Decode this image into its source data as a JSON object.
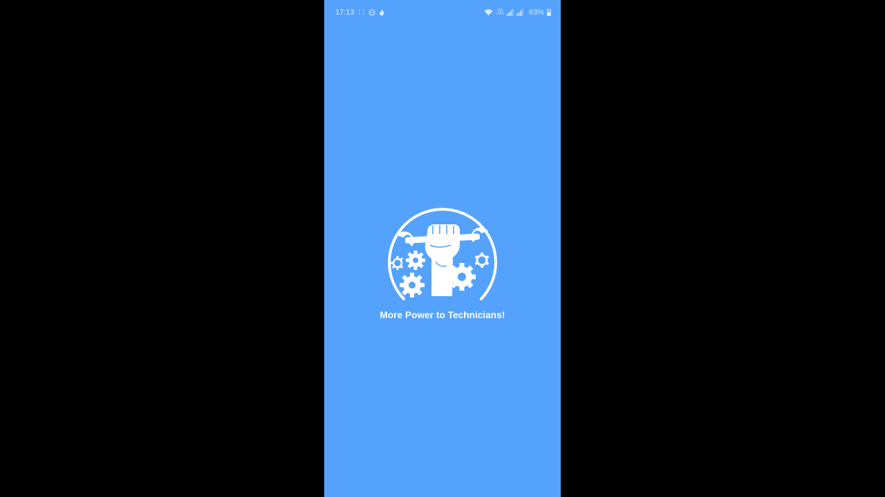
{
  "status_bar": {
    "time": "17:13",
    "left_icons": [
      "notification-dots-icon",
      "do-not-disturb-icon",
      "fire-icon"
    ],
    "right_icons": [
      "wifi-icon",
      "volte-icon",
      "signal-icon",
      "signal-icon",
      "battery-icon"
    ],
    "volte_top": "Vo)",
    "volte_bottom": "LTE1",
    "battery_percent": "63%",
    "battery_level": 0.63
  },
  "splash": {
    "logo": "technician-logo",
    "tagline": "More Power to Technicians!"
  },
  "colors": {
    "background": "#55a2fd",
    "letterbox": "#000000",
    "foreground": "#ffffff"
  }
}
